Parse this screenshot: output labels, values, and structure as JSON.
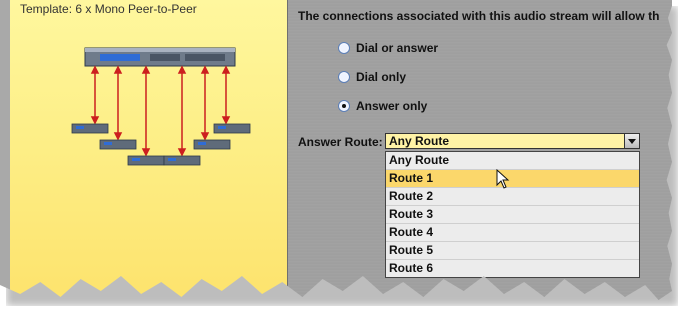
{
  "template_title": "Template: 6 x Mono Peer-to-Peer",
  "intro_text": "The connections associated with this audio stream will allow th",
  "radio_options": [
    {
      "label": "Dial or answer",
      "checked": false
    },
    {
      "label": "Dial only",
      "checked": false
    },
    {
      "label": "Answer only",
      "checked": true
    }
  ],
  "answer_route": {
    "label": "Answer Route:",
    "selected": "Any Route",
    "options": [
      "Any Route",
      "Route 1",
      "Route 2",
      "Route 3",
      "Route 4",
      "Route 5",
      "Route 6"
    ],
    "highlighted": "Route 1"
  },
  "colors": {
    "accent_yellow": "#fde36d",
    "hover": "#fbd76b",
    "arrow_red": "#cc1f1f"
  },
  "icons": {
    "cursor": "arrow-cursor-icon",
    "dropdown": "chevron-down-icon",
    "device": "rack-device-icon"
  }
}
